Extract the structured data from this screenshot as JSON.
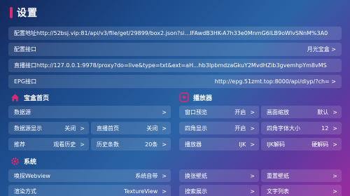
{
  "title": "设置",
  "top_rows": [
    {
      "label": "配置地址http://52bsj.vip:81/api/v3/file/get/29899/box2.json?si...IFAwdB3HK-A7h33e0MnmG6lLB9oWlvSNnM%3A0",
      "value": ""
    },
    {
      "label": "配置接口",
      "value": "月光宝盒 >"
    },
    {
      "label": "直播接口http://127.0.0.1:9978/proxy?do=live&type=txt&ext=aH...hb3IpbmdzaGkuY2MvdHZib3gvemhpYm8vMS",
      "value": ""
    },
    {
      "label": "EPG接口",
      "value": "http://epg.51zmt.top:8000/api/diyp/?ch= >"
    }
  ],
  "sections": {
    "home": {
      "title": "宝盒首页"
    },
    "player": {
      "title": "播放器"
    },
    "system": {
      "title": "系统"
    }
  },
  "home_rows": [
    [
      {
        "label": "数据源",
        "value": "",
        "arrow": ">"
      }
    ],
    [
      {
        "label": "数据源显示",
        "value": "关闭",
        "arrow": ">"
      },
      {
        "label": "直播首页",
        "value": "关闭",
        "arrow": ">"
      }
    ],
    [
      {
        "label": "推荐",
        "value": "观看历史",
        "arrow": ">"
      },
      {
        "label": "历史条数",
        "value": "20条",
        "arrow": ">"
      }
    ]
  ],
  "player_rows": [
    [
      {
        "label": "窗口预览",
        "value": "开启",
        "arrow": ">"
      },
      {
        "label": "画面缩放",
        "value": "默认",
        "arrow": ">"
      }
    ],
    [
      {
        "label": "四角显示",
        "value": "开启",
        "arrow": ">"
      },
      {
        "label": "四角字体大小",
        "value": "12",
        "arrow": ">"
      }
    ],
    [
      {
        "label": "播放器",
        "value": "IJK",
        "arrow": ">"
      },
      {
        "label": "IJK解码",
        "value": "硬解码",
        "arrow": ">"
      }
    ]
  ],
  "system_rows": [
    [
      {
        "label": "唤探Webview",
        "value": "系统自带",
        "arrow": ">"
      },
      {
        "label": "换张壁纸",
        "value": "",
        "arrow": ">"
      },
      {
        "label": "重置壁纸",
        "value": "",
        "arrow": ">"
      }
    ],
    [
      {
        "label": "渲染方式",
        "value": "TextureView",
        "arrow": ">"
      },
      {
        "label": "搜索展示",
        "value": "",
        "arrow": ">"
      },
      {
        "label": "文字列表",
        "value": "",
        "arrow": ">"
      }
    ]
  ],
  "colors": {
    "accent": "#e0286e"
  }
}
